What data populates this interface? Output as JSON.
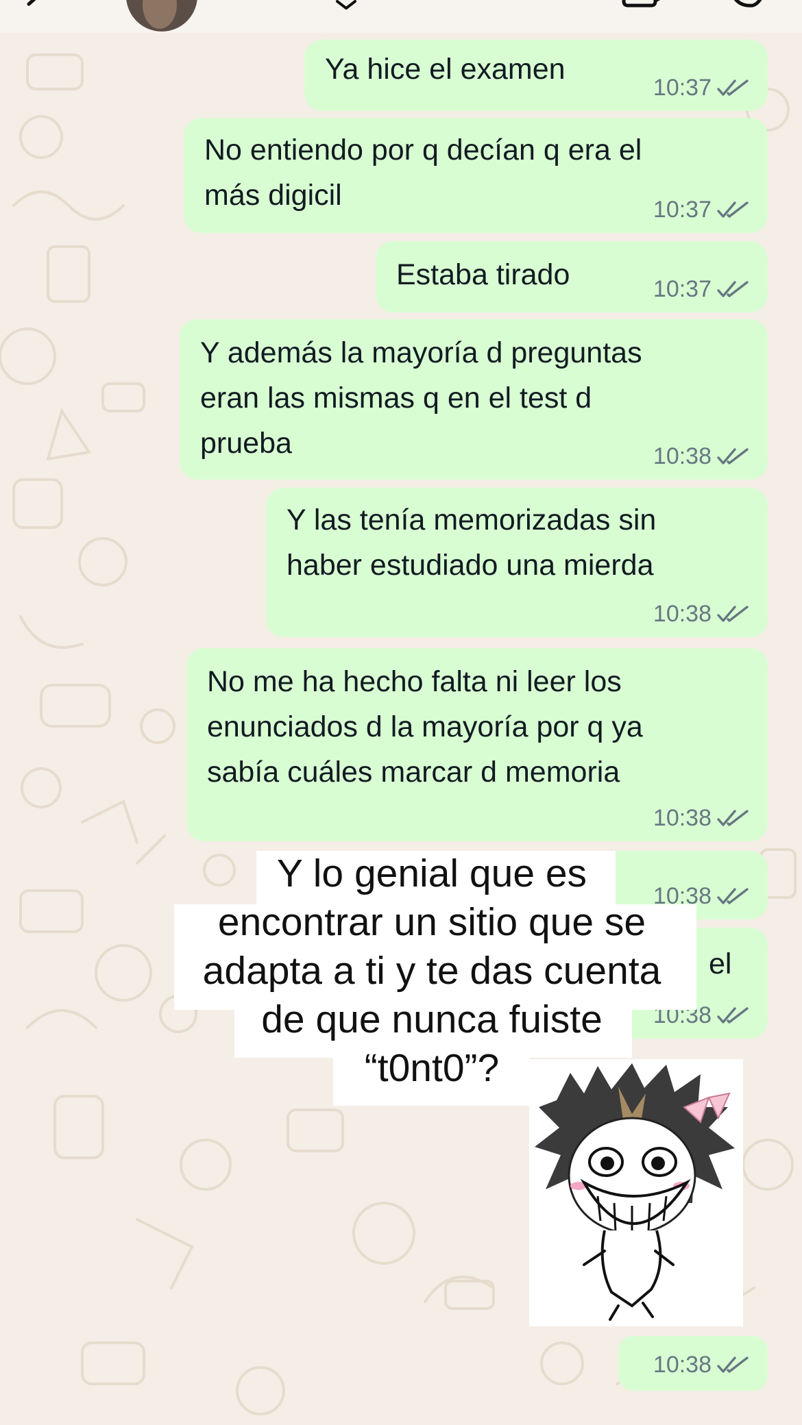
{
  "header": {
    "avatar": "contact-avatar",
    "icons": [
      "back-chevron-icon",
      "dropdown-chevron-icon",
      "video-call-icon",
      "phone-call-icon"
    ]
  },
  "messages": [
    {
      "text": "Ya hice el examen",
      "time": "10:37",
      "status": "read-double-check"
    },
    {
      "text": "No entiendo por q decían q era el\nmás digicil",
      "time": "10:37",
      "status": "read-double-check"
    },
    {
      "text": "Estaba tirado",
      "time": "10:37",
      "status": "read-double-check"
    },
    {
      "text": "Y además la mayoría d preguntas\neran las mismas q en el test d\nprueba",
      "time": "10:38",
      "status": "read-double-check"
    },
    {
      "text": "Y las tenía memorizadas sin\nhaber estudiado una mierda",
      "time": "10:38",
      "status": "read-double-check"
    },
    {
      "text": "No me ha hecho falta ni leer los\nenunciados d la mayoría por q ya\nsabía cuáles marcar d memoria",
      "time": "10:38",
      "status": "read-double-check"
    },
    {
      "text": "",
      "time": "10:38",
      "status": "read-double-check"
    },
    {
      "text": "el",
      "time": "10:38",
      "status": "read-double-check"
    }
  ],
  "meme_overlay": {
    "lines": [
      "Y lo genial que es",
      "encontrar un sitio que se",
      "adapta a ti y te das cuenta",
      "de que nunca fuiste",
      "“t0nt0”?"
    ]
  },
  "sticker": {
    "description_icon": "trollface-anime-sticker-icon",
    "time": "10:38",
    "status": "read-double-check"
  },
  "colors": {
    "outgoing_bubble": "#d9fdd3",
    "wallpaper": "#f4eee6",
    "meta_text": "#667781",
    "doodle": "#e6dccd"
  }
}
